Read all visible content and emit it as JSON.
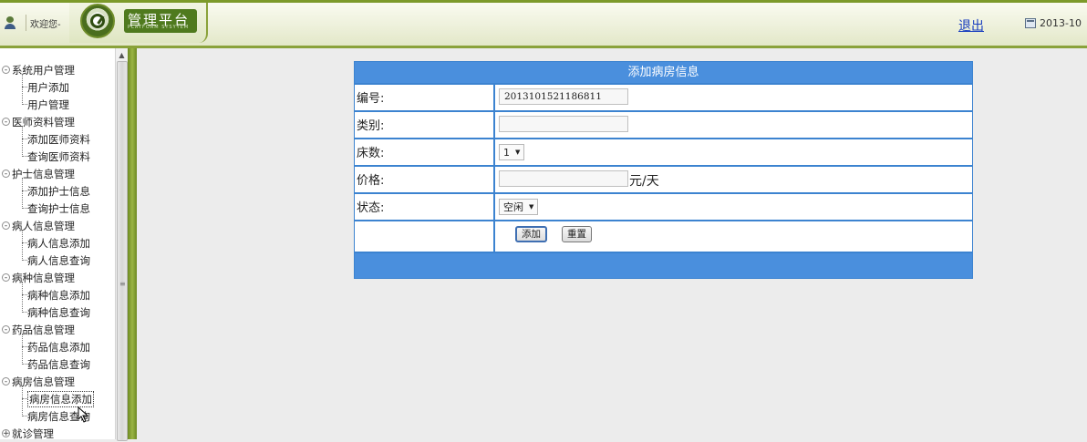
{
  "header": {
    "welcome": "欢迎您-",
    "platform_title": "管理平台",
    "platform_subtitle": "PLATFORM SYSYTEM",
    "logout": "退出",
    "date": "2013-10"
  },
  "sidebar": {
    "groups": [
      {
        "label": "系统用户管理",
        "items": [
          "用户添加",
          "用户管理"
        ]
      },
      {
        "label": "医师资料管理",
        "items": [
          "添加医师资料",
          "查询医师资料"
        ]
      },
      {
        "label": "护士信息管理",
        "items": [
          "添加护士信息",
          "查询护士信息"
        ]
      },
      {
        "label": "病人信息管理",
        "items": [
          "病人信息添加",
          "病人信息查询"
        ]
      },
      {
        "label": "病种信息管理",
        "items": [
          "病种信息添加",
          "病种信息查询"
        ]
      },
      {
        "label": "药品信息管理",
        "items": [
          "药品信息添加",
          "药品信息查询"
        ]
      },
      {
        "label": "病房信息管理",
        "items": [
          "病房信息添加",
          "病房信息查询"
        ]
      },
      {
        "label": "就诊管理",
        "items": []
      }
    ]
  },
  "form": {
    "title": "添加病房信息",
    "fields": {
      "number": {
        "label": "编号:",
        "value": "2013101521186811"
      },
      "category": {
        "label": "类别:",
        "value": ""
      },
      "beds": {
        "label": "床数:",
        "value": "1"
      },
      "price": {
        "label": "价格:",
        "value": "",
        "unit": "元/天"
      },
      "status": {
        "label": "状态:",
        "value": "空闲"
      }
    },
    "buttons": {
      "add": "添加",
      "reset": "重置"
    }
  },
  "colors": {
    "accent_blue": "#4a8fdd",
    "border_blue": "#3c83d0",
    "header_green": "#8aa23a",
    "link_blue": "#1a3fbf"
  },
  "icons": [
    "user-icon",
    "logo-icon",
    "calendar-icon",
    "expand-icon",
    "collapse-icon",
    "cursor-icon",
    "scroll-up-icon",
    "dropdown-arrow-icon"
  ]
}
